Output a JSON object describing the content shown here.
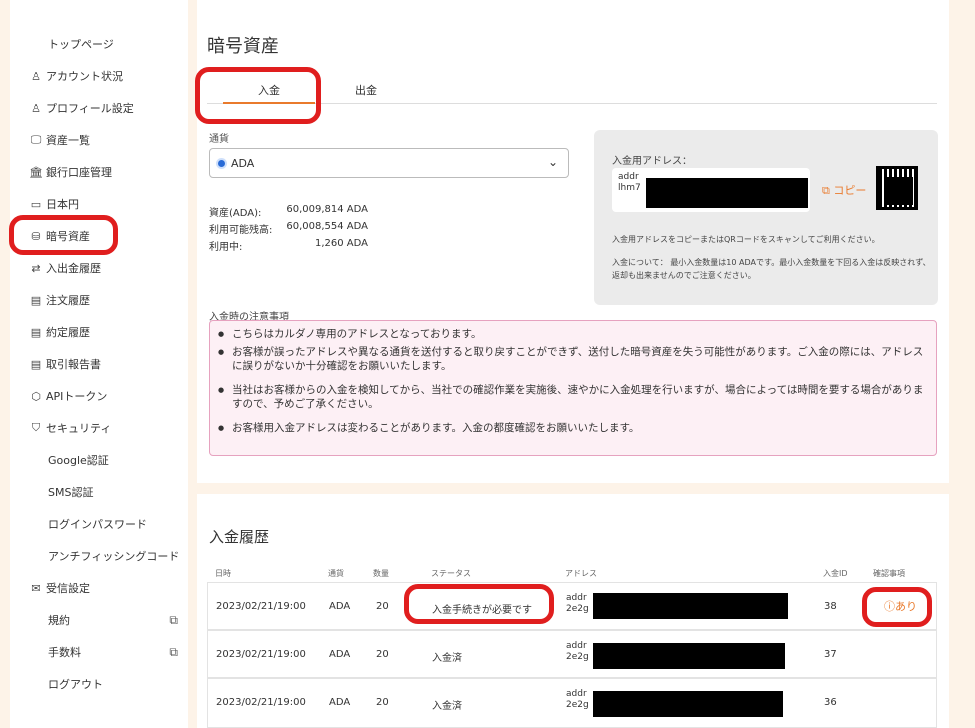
{
  "sidebar": {
    "items": [
      {
        "icon": "",
        "label": "トップページ",
        "sub": true
      },
      {
        "icon": "user-icon",
        "glyph": "♙",
        "label": "アカウント状況"
      },
      {
        "icon": "user-icon",
        "glyph": "♙",
        "label": "プロフィール設定"
      },
      {
        "icon": "monitor-icon",
        "glyph": "🖵",
        "label": "資産一覧"
      },
      {
        "icon": "bank-icon",
        "glyph": "🏛",
        "label": "銀行口座管理"
      },
      {
        "icon": "cash-icon",
        "glyph": "▭",
        "label": "日本円"
      },
      {
        "icon": "coins-icon",
        "glyph": "⛁",
        "label": "暗号資産"
      },
      {
        "icon": "transfer-icon",
        "glyph": "⇄",
        "label": "入出金履歴"
      },
      {
        "icon": "document-icon",
        "glyph": "▤",
        "label": "注文履歴"
      },
      {
        "icon": "document-icon",
        "glyph": "▤",
        "label": "約定履歴"
      },
      {
        "icon": "document-icon",
        "glyph": "▤",
        "label": "取引報告書"
      },
      {
        "icon": "api-icon",
        "glyph": "⬡",
        "label": "APIトークン"
      },
      {
        "icon": "shield-icon",
        "glyph": "⛉",
        "label": "セキュリティ"
      },
      {
        "icon": "",
        "label": "Google認証",
        "sub": true
      },
      {
        "icon": "",
        "label": "SMS認証",
        "sub": true
      },
      {
        "icon": "",
        "label": "ログインパスワード",
        "sub": true
      },
      {
        "icon": "",
        "label": "アンチフィッシングコード",
        "sub": true
      },
      {
        "icon": "mail-icon",
        "glyph": "✉",
        "label": "受信設定"
      },
      {
        "icon": "",
        "label": "規約",
        "sub": true,
        "external": true
      },
      {
        "icon": "",
        "label": "手数料",
        "sub": true,
        "external": true
      },
      {
        "icon": "",
        "label": "ログアウト",
        "sub": true
      }
    ]
  },
  "main": {
    "title": "暗号資産",
    "tabs": [
      {
        "label": "入金"
      },
      {
        "label": "出金"
      }
    ],
    "currency_label": "通貨",
    "currency_value": "ADA",
    "balances": [
      {
        "label": "資産(ADA):",
        "value": "60,009,814 ADA"
      },
      {
        "label": "利用可能残高:",
        "value": "60,008,554 ADA"
      },
      {
        "label": "利用中:",
        "value": "1,260 ADA"
      }
    ],
    "deposit_address": {
      "label": "入金用アドレス：",
      "line1": "addr",
      "line2": "lhm7",
      "copy_label": "コピー",
      "note": "入金用アドレスをコピーまたはQRコードをスキャンしてご利用ください。",
      "min_label": "入金について：",
      "min_text": "最小入金数量は10 ADAです。最小入金数量を下回る入金は反映されず、返却も出来ませんのでご注意ください。"
    },
    "caution_title": "入金時の注意事項",
    "cautions": [
      "こちらはカルダノ専用のアドレスとなっております。",
      "お客様が誤ったアドレスや異なる通貨を送付すると取り戻すことができず、送付した暗号資産を失う可能性があります。ご入金の際には、アドレスに誤りがないか十分確認をお願いいたします。",
      "当社はお客様からの入金を検知してから、当社での確認作業を実施後、速やかに入金処理を行いますが、場合によっては時間を要する場合がありますので、予めご了承ください。",
      "お客様用入金アドレスは変わることがあります。入金の都度確認をお願いいたします。"
    ]
  },
  "history": {
    "title": "入金履歴",
    "columns": [
      "日時",
      "通貨",
      "数量",
      "ステータス",
      "アドレス",
      "入金ID",
      "確認事項"
    ],
    "rows": [
      {
        "datetime": "2023/02/21/19:00",
        "currency": "ADA",
        "qty": "20",
        "status": "入金手続きが必要です",
        "addr1": "addr",
        "addr2": "2e2g",
        "id": "38",
        "check": "あり"
      },
      {
        "datetime": "2023/02/21/19:00",
        "currency": "ADA",
        "qty": "20",
        "status": "入金済",
        "addr1": "addr",
        "addr2": "2e2g",
        "id": "37",
        "check": ""
      },
      {
        "datetime": "2023/02/21/19:00",
        "currency": "ADA",
        "qty": "20",
        "status": "入金済",
        "addr1": "addr",
        "addr2": "2e2g",
        "id": "36",
        "check": ""
      }
    ]
  },
  "colors": {
    "accent": "#e97a2c",
    "annotation": "#e01e1e",
    "caution_bg": "#fdf0f5"
  }
}
